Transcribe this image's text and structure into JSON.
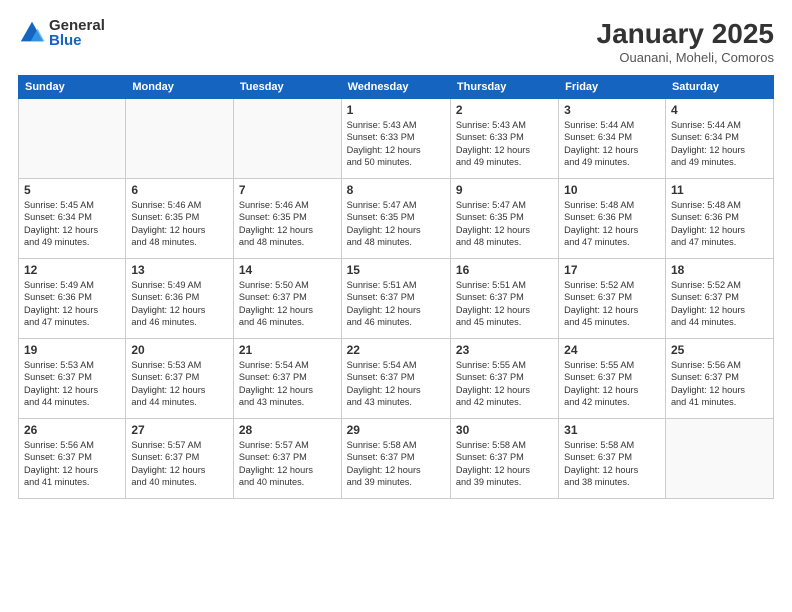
{
  "header": {
    "logo_general": "General",
    "logo_blue": "Blue",
    "month_title": "January 2025",
    "subtitle": "Ouanani, Moheli, Comoros"
  },
  "weekdays": [
    "Sunday",
    "Monday",
    "Tuesday",
    "Wednesday",
    "Thursday",
    "Friday",
    "Saturday"
  ],
  "weeks": [
    [
      {
        "day": "",
        "info": ""
      },
      {
        "day": "",
        "info": ""
      },
      {
        "day": "",
        "info": ""
      },
      {
        "day": "1",
        "info": "Sunrise: 5:43 AM\nSunset: 6:33 PM\nDaylight: 12 hours\nand 50 minutes."
      },
      {
        "day": "2",
        "info": "Sunrise: 5:43 AM\nSunset: 6:33 PM\nDaylight: 12 hours\nand 49 minutes."
      },
      {
        "day": "3",
        "info": "Sunrise: 5:44 AM\nSunset: 6:34 PM\nDaylight: 12 hours\nand 49 minutes."
      },
      {
        "day": "4",
        "info": "Sunrise: 5:44 AM\nSunset: 6:34 PM\nDaylight: 12 hours\nand 49 minutes."
      }
    ],
    [
      {
        "day": "5",
        "info": "Sunrise: 5:45 AM\nSunset: 6:34 PM\nDaylight: 12 hours\nand 49 minutes."
      },
      {
        "day": "6",
        "info": "Sunrise: 5:46 AM\nSunset: 6:35 PM\nDaylight: 12 hours\nand 48 minutes."
      },
      {
        "day": "7",
        "info": "Sunrise: 5:46 AM\nSunset: 6:35 PM\nDaylight: 12 hours\nand 48 minutes."
      },
      {
        "day": "8",
        "info": "Sunrise: 5:47 AM\nSunset: 6:35 PM\nDaylight: 12 hours\nand 48 minutes."
      },
      {
        "day": "9",
        "info": "Sunrise: 5:47 AM\nSunset: 6:35 PM\nDaylight: 12 hours\nand 48 minutes."
      },
      {
        "day": "10",
        "info": "Sunrise: 5:48 AM\nSunset: 6:36 PM\nDaylight: 12 hours\nand 47 minutes."
      },
      {
        "day": "11",
        "info": "Sunrise: 5:48 AM\nSunset: 6:36 PM\nDaylight: 12 hours\nand 47 minutes."
      }
    ],
    [
      {
        "day": "12",
        "info": "Sunrise: 5:49 AM\nSunset: 6:36 PM\nDaylight: 12 hours\nand 47 minutes."
      },
      {
        "day": "13",
        "info": "Sunrise: 5:49 AM\nSunset: 6:36 PM\nDaylight: 12 hours\nand 46 minutes."
      },
      {
        "day": "14",
        "info": "Sunrise: 5:50 AM\nSunset: 6:37 PM\nDaylight: 12 hours\nand 46 minutes."
      },
      {
        "day": "15",
        "info": "Sunrise: 5:51 AM\nSunset: 6:37 PM\nDaylight: 12 hours\nand 46 minutes."
      },
      {
        "day": "16",
        "info": "Sunrise: 5:51 AM\nSunset: 6:37 PM\nDaylight: 12 hours\nand 45 minutes."
      },
      {
        "day": "17",
        "info": "Sunrise: 5:52 AM\nSunset: 6:37 PM\nDaylight: 12 hours\nand 45 minutes."
      },
      {
        "day": "18",
        "info": "Sunrise: 5:52 AM\nSunset: 6:37 PM\nDaylight: 12 hours\nand 44 minutes."
      }
    ],
    [
      {
        "day": "19",
        "info": "Sunrise: 5:53 AM\nSunset: 6:37 PM\nDaylight: 12 hours\nand 44 minutes."
      },
      {
        "day": "20",
        "info": "Sunrise: 5:53 AM\nSunset: 6:37 PM\nDaylight: 12 hours\nand 44 minutes."
      },
      {
        "day": "21",
        "info": "Sunrise: 5:54 AM\nSunset: 6:37 PM\nDaylight: 12 hours\nand 43 minutes."
      },
      {
        "day": "22",
        "info": "Sunrise: 5:54 AM\nSunset: 6:37 PM\nDaylight: 12 hours\nand 43 minutes."
      },
      {
        "day": "23",
        "info": "Sunrise: 5:55 AM\nSunset: 6:37 PM\nDaylight: 12 hours\nand 42 minutes."
      },
      {
        "day": "24",
        "info": "Sunrise: 5:55 AM\nSunset: 6:37 PM\nDaylight: 12 hours\nand 42 minutes."
      },
      {
        "day": "25",
        "info": "Sunrise: 5:56 AM\nSunset: 6:37 PM\nDaylight: 12 hours\nand 41 minutes."
      }
    ],
    [
      {
        "day": "26",
        "info": "Sunrise: 5:56 AM\nSunset: 6:37 PM\nDaylight: 12 hours\nand 41 minutes."
      },
      {
        "day": "27",
        "info": "Sunrise: 5:57 AM\nSunset: 6:37 PM\nDaylight: 12 hours\nand 40 minutes."
      },
      {
        "day": "28",
        "info": "Sunrise: 5:57 AM\nSunset: 6:37 PM\nDaylight: 12 hours\nand 40 minutes."
      },
      {
        "day": "29",
        "info": "Sunrise: 5:58 AM\nSunset: 6:37 PM\nDaylight: 12 hours\nand 39 minutes."
      },
      {
        "day": "30",
        "info": "Sunrise: 5:58 AM\nSunset: 6:37 PM\nDaylight: 12 hours\nand 39 minutes."
      },
      {
        "day": "31",
        "info": "Sunrise: 5:58 AM\nSunset: 6:37 PM\nDaylight: 12 hours\nand 38 minutes."
      },
      {
        "day": "",
        "info": ""
      }
    ]
  ]
}
